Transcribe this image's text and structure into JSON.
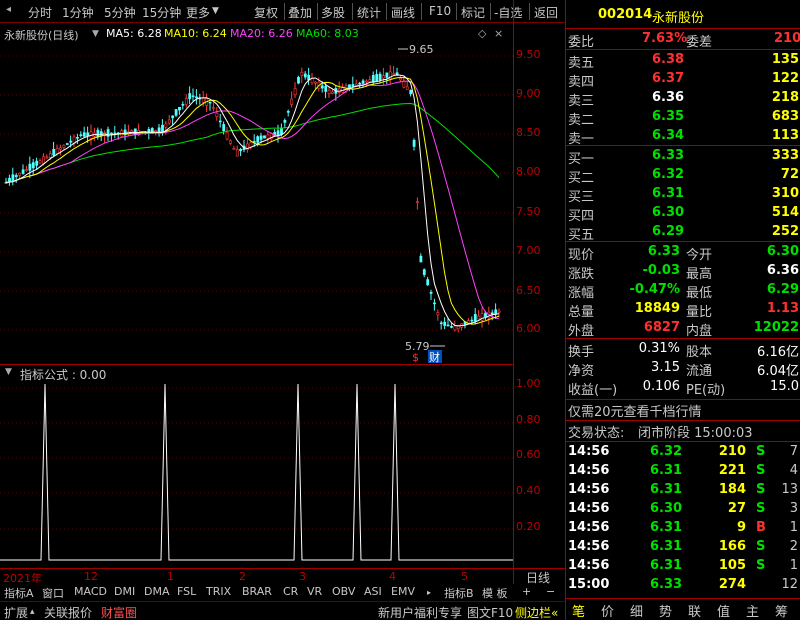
{
  "toolbar": {
    "left": [
      "分时",
      "1分钟",
      "5分钟",
      "15分钟",
      "更多"
    ],
    "right": [
      "复权",
      "叠加",
      "多股",
      "统计",
      "画线",
      "F10",
      "标记",
      "-自选",
      "返回"
    ]
  },
  "chart_header": {
    "stock_title": "永新股份(日线)",
    "ma5": "MA5: 6.28",
    "ma10": "MA10: 6.24",
    "ma20": "MA20: 6.26",
    "ma60": "MA60: 8.03",
    "colors": {
      "ma5": "#ffffff",
      "ma10": "#ffff00",
      "ma20": "#ff40ff",
      "ma60": "#00e000"
    }
  },
  "annotations": {
    "high": "9.65",
    "low": "5.79",
    "icon_s": "$",
    "icon_cai": "财"
  },
  "price_axis": [
    "9.50",
    "9.00",
    "8.50",
    "8.00",
    "7.50",
    "7.00",
    "6.50",
    "6.00"
  ],
  "indicator": {
    "title": "指标公式 : 0.00",
    "axis": [
      "1.00",
      "0.80",
      "0.60",
      "0.40",
      "0.20"
    ]
  },
  "date_axis": {
    "labels": [
      "2021年",
      "12",
      "1",
      "2",
      "3",
      "4",
      "5"
    ],
    "period": "日线"
  },
  "tabs": [
    "指标A",
    "窗口",
    "MACD",
    "DMI",
    "DMA",
    "FSL",
    "TRIX",
    "BRAR",
    "CR",
    "VR",
    "OBV",
    "ASI",
    "EMV",
    "指标B",
    "模 板",
    "+",
    "−"
  ],
  "bottombar": {
    "left": [
      "扩展",
      "关联报价",
      "财富圈"
    ],
    "promo": "新用户福利专享",
    "right": [
      "图文F10",
      "侧边栏«"
    ]
  },
  "quote": {
    "code": "002014",
    "name": "永新股份",
    "weibi_label": "委比",
    "weibi": "7.63%",
    "weicha_label": "委差",
    "weicha": "210",
    "asks": [
      {
        "label": "卖五",
        "price": "6.38",
        "vol": "135"
      },
      {
        "label": "卖四",
        "price": "6.37",
        "vol": "122"
      },
      {
        "label": "卖三",
        "price": "6.36",
        "vol": "218"
      },
      {
        "label": "卖二",
        "price": "6.35",
        "vol": "683"
      },
      {
        "label": "卖一",
        "price": "6.34",
        "vol": "113"
      }
    ],
    "bids": [
      {
        "label": "买一",
        "price": "6.33",
        "vol": "333"
      },
      {
        "label": "买二",
        "price": "6.32",
        "vol": "72"
      },
      {
        "label": "买三",
        "price": "6.31",
        "vol": "310"
      },
      {
        "label": "买四",
        "price": "6.30",
        "vol": "514"
      },
      {
        "label": "买五",
        "price": "6.29",
        "vol": "252"
      }
    ],
    "stats": [
      {
        "l1": "现价",
        "v1": "6.33",
        "l2": "今开",
        "v2": "6.30"
      },
      {
        "l1": "涨跌",
        "v1": "-0.03",
        "l2": "最高",
        "v2": "6.36"
      },
      {
        "l1": "涨幅",
        "v1": "-0.47%",
        "l2": "最低",
        "v2": "6.29"
      },
      {
        "l1": "总量",
        "v1": "18849",
        "l2": "量比",
        "v2": "1.13"
      },
      {
        "l1": "外盘",
        "v1": "6827",
        "l2": "内盘",
        "v2": "12022"
      }
    ],
    "stats2": [
      {
        "l1": "换手",
        "v1": "0.31%",
        "l2": "股本",
        "v2": "6.16亿"
      },
      {
        "l1": "净资",
        "v1": "3.15",
        "l2": "流通",
        "v2": "6.04亿"
      },
      {
        "l1": "收益(一)",
        "v1": "0.106",
        "l2": "PE(动)",
        "v2": "15.0"
      }
    ],
    "promo": "仅需20元查看千档行情",
    "status_label": "交易状态:",
    "status": "闭市阶段 15:00:03",
    "ticks": [
      {
        "t": "14:56",
        "p": "6.32",
        "v": "210",
        "s": "S",
        "n": "7"
      },
      {
        "t": "14:56",
        "p": "6.31",
        "v": "221",
        "s": "S",
        "n": "4"
      },
      {
        "t": "14:56",
        "p": "6.31",
        "v": "184",
        "s": "S",
        "n": "13"
      },
      {
        "t": "14:56",
        "p": "6.30",
        "v": "27",
        "s": "S",
        "n": "3"
      },
      {
        "t": "14:56",
        "p": "6.31",
        "v": "9",
        "s": "B",
        "n": "1"
      },
      {
        "t": "14:56",
        "p": "6.31",
        "v": "166",
        "s": "S",
        "n": "2"
      },
      {
        "t": "14:56",
        "p": "6.31",
        "v": "105",
        "s": "S",
        "n": "1"
      },
      {
        "t": "15:00",
        "p": "6.33",
        "v": "274",
        "s": "",
        "n": "12"
      }
    ],
    "bottom_tabs": [
      "笔",
      "价",
      "细",
      "势",
      "联",
      "值",
      "主",
      "筹"
    ]
  }
}
